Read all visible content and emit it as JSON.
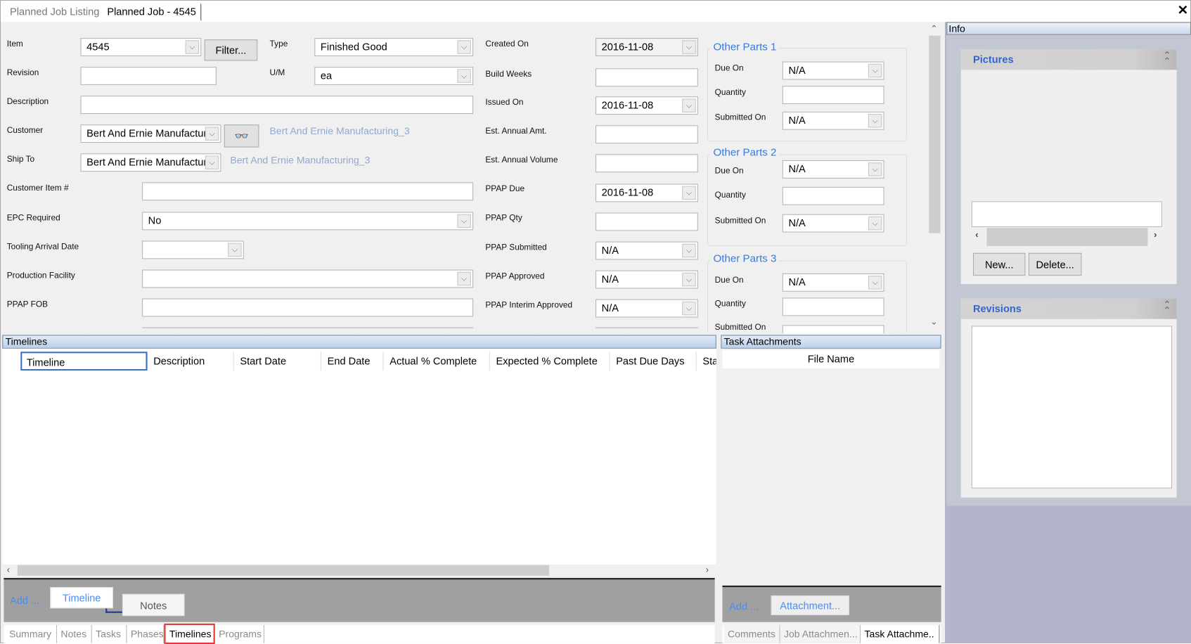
{
  "tabs": [
    {
      "label": "Planned Job Listing",
      "active": false
    },
    {
      "label": "Planned Job - 4545",
      "active": true
    }
  ],
  "close_icon": "close-icon",
  "form": {
    "item": {
      "label": "Item",
      "value": "4545"
    },
    "filter_button": "Filter...",
    "type": {
      "label": "Type",
      "value": "Finished Good"
    },
    "revision": {
      "label": "Revision",
      "value": ""
    },
    "um": {
      "label": "U/M",
      "value": "ea"
    },
    "description": {
      "label": "Description",
      "value": ""
    },
    "customer": {
      "label": "Customer",
      "value": "Bert And Ernie Manufacturi",
      "link": "Bert And Ernie Manufacturing_3"
    },
    "ship_to": {
      "label": "Ship To",
      "value": "Bert And Ernie Manufacturi",
      "link": "Bert And Ernie Manufacturing_3"
    },
    "customer_item": {
      "label": "Customer Item #",
      "value": ""
    },
    "epc_required": {
      "label": "EPC Required",
      "value": "No"
    },
    "tooling_arrival": {
      "label": "Tooling Arrival Date",
      "value": ""
    },
    "production_facility": {
      "label": "Production Facility",
      "value": ""
    },
    "ppap_fob": {
      "label": "PPAP FOB",
      "value": ""
    },
    "created_on": {
      "label": "Created On",
      "value": "2016-11-08"
    },
    "build_weeks": {
      "label": "Build Weeks",
      "value": ""
    },
    "issued_on": {
      "label": "Issued On",
      "value": "2016-11-08"
    },
    "est_annual_amt": {
      "label": "Est. Annual Amt.",
      "value": ""
    },
    "est_annual_volume": {
      "label": "Est. Annual Volume",
      "value": ""
    },
    "ppap_due": {
      "label": "PPAP Due",
      "value": "2016-11-08"
    },
    "ppap_qty": {
      "label": "PPAP Qty",
      "value": ""
    },
    "ppap_submitted": {
      "label": "PPAP Submitted",
      "value": "N/A"
    },
    "ppap_approved": {
      "label": "PPAP Approved",
      "value": "N/A"
    },
    "ppap_interim": {
      "label": "PPAP Interim Approved",
      "value": "N/A"
    },
    "other_parts": [
      {
        "title": "Other Parts 1",
        "due_label": "Due On",
        "due": "N/A",
        "qty_label": "Quantity",
        "qty": "",
        "sub_label": "Submitted On",
        "sub": "N/A"
      },
      {
        "title": "Other Parts 2",
        "due_label": "Due On",
        "due": "N/A",
        "qty_label": "Quantity",
        "qty": "",
        "sub_label": "Submitted On",
        "sub": "N/A"
      },
      {
        "title": "Other Parts 3",
        "due_label": "Due On",
        "due": "N/A",
        "qty_label": "Quantity",
        "qty": "",
        "sub_label": "Submitted On",
        "sub": "N/A"
      }
    ]
  },
  "timelines": {
    "header": "Timelines",
    "columns": [
      "Timeline",
      "Description",
      "Start Date",
      "End Date",
      "Actual % Complete",
      "Expected % Complete",
      "Past Due Days",
      "Statu"
    ],
    "add_label": "Add ...",
    "timeline_button": "Timeline",
    "notes_button": "Notes"
  },
  "bottom_tabs": [
    {
      "label": "Summary"
    },
    {
      "label": "Notes"
    },
    {
      "label": "Tasks"
    },
    {
      "label": "Phases"
    },
    {
      "label": "Timelines",
      "active": true
    },
    {
      "label": "Programs"
    }
  ],
  "task_attachments": {
    "header": "Task Attachments",
    "column": "File Name",
    "add_label": "Add ...",
    "attachment_button": "Attachment...",
    "tabs": [
      {
        "label": "Comments"
      },
      {
        "label": "Job Attachmen..."
      },
      {
        "label": "Task Attachme..",
        "active": true
      }
    ]
  },
  "info": {
    "header": "Info",
    "pictures": {
      "title": "Pictures",
      "new_button": "New...",
      "delete_button": "Delete..."
    },
    "revisions": {
      "title": "Revisions"
    }
  },
  "colors": {
    "accent": "#3366cc",
    "link": "#8fa8d4",
    "highlight": "#e53935",
    "side_bg": "#b3b5cb"
  }
}
